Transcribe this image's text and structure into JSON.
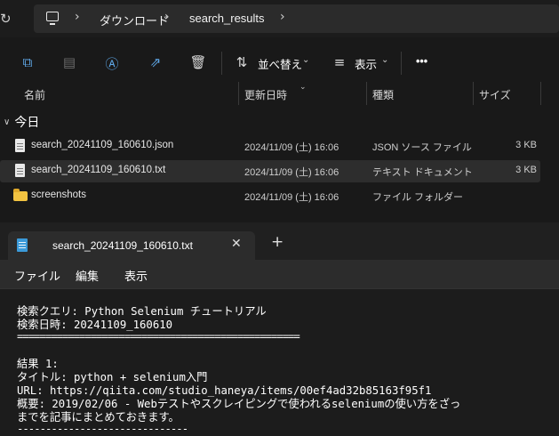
{
  "address_bar": {
    "breadcrumbs": [
      "ダウンロード",
      "search_results"
    ]
  },
  "toolbar": {
    "sort_label": "並べ替え",
    "view_label": "表示",
    "more_label": "•••"
  },
  "columns": [
    "名前",
    "更新日時",
    "種類",
    "サイズ"
  ],
  "group_label": "今日",
  "files": [
    {
      "name": "search_20241109_160610.json",
      "modified": "2024/11/09 (土) 16:06",
      "type": "JSON ソース ファイル",
      "size": "3 KB",
      "icon": "document-icon",
      "selected": false
    },
    {
      "name": "search_20241109_160610.txt",
      "modified": "2024/11/09 (土) 16:06",
      "type": "テキスト ドキュメント",
      "size": "3 KB",
      "icon": "document-icon",
      "selected": true
    },
    {
      "name": "screenshots",
      "modified": "2024/11/09 (土) 16:06",
      "type": "ファイル フォルダー",
      "size": "",
      "icon": "folder-icon",
      "selected": false
    }
  ],
  "notepad": {
    "tab_title": "search_20241109_160610.txt",
    "menu": [
      "ファイル",
      "編集",
      "表示"
    ],
    "lines": [
      "検索クエリ: Python Selenium チュートリアル",
      "検索日時: 20241109_160610",
      "==================================================",
      "",
      "結果 1:",
      "タイトル: python + selenium入門",
      "URL: https://qiita.com/studio_haneya/items/00ef4ad32b85163f95f1",
      "概要: 2019/02/06 - Webテストやスクレイピングで使われるseleniumの使い方をざっ",
      "までを記事にまとめておきます。",
      "------------------------------"
    ]
  },
  "colors": {
    "background": "#191919",
    "accent": "#5fa8e8",
    "selected_row": "#2d2d2d",
    "folder": "#f2c341"
  }
}
